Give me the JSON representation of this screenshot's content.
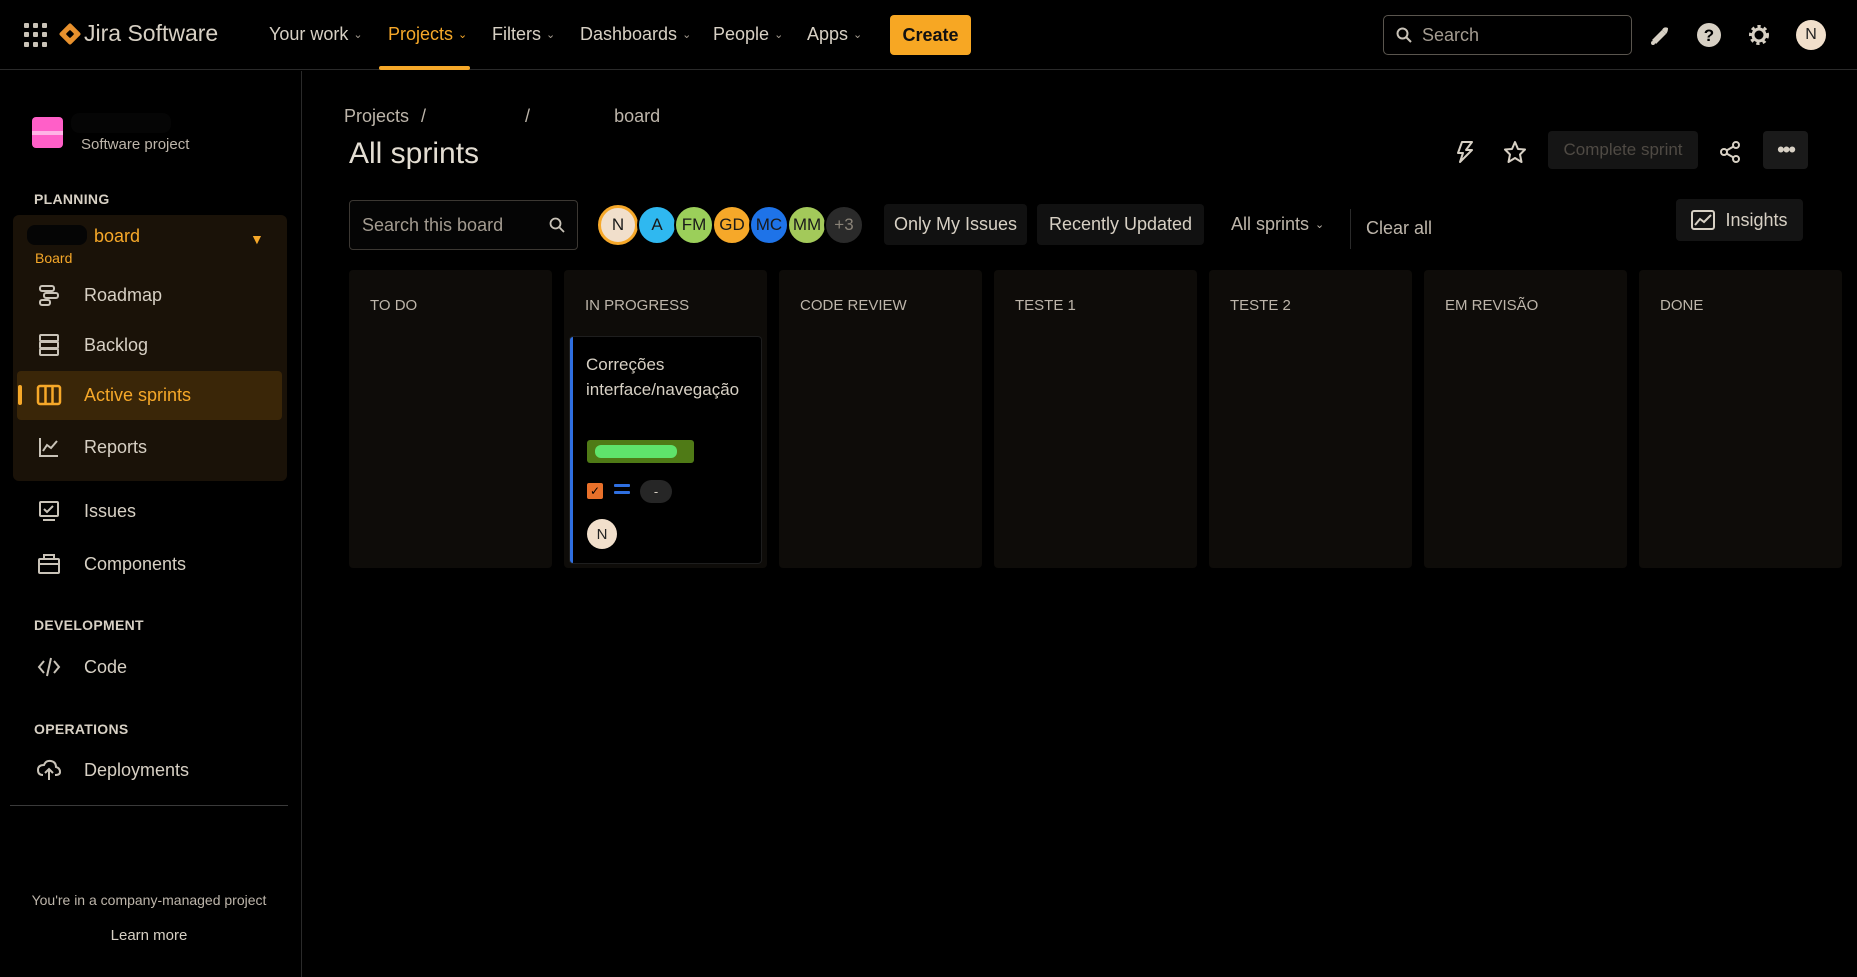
{
  "topnav": {
    "product": "Jira Software",
    "items": [
      {
        "label": "Your work"
      },
      {
        "label": "Projects"
      },
      {
        "label": "Filters"
      },
      {
        "label": "Dashboards"
      },
      {
        "label": "People"
      },
      {
        "label": "Apps"
      }
    ],
    "create_label": "Create",
    "search_placeholder": "Search",
    "user_initial": "N",
    "icons": [
      "notifications-icon",
      "help-icon",
      "settings-icon"
    ]
  },
  "sidebar": {
    "project_type": "Software project",
    "planning_title": "PLANNING",
    "board_title": "board",
    "board_subtitle": "Board",
    "planning_items": [
      {
        "label": "Roadmap",
        "icon": "roadmap-icon"
      },
      {
        "label": "Backlog",
        "icon": "backlog-icon"
      },
      {
        "label": "Active sprints",
        "icon": "board-columns-icon"
      },
      {
        "label": "Reports",
        "icon": "reports-icon"
      }
    ],
    "other_items": [
      {
        "label": "Issues",
        "icon": "issues-icon"
      },
      {
        "label": "Components",
        "icon": "components-icon"
      }
    ],
    "development_title": "DEVELOPMENT",
    "development_items": [
      {
        "label": "Code",
        "icon": "code-icon"
      }
    ],
    "operations_title": "OPERATIONS",
    "operations_items": [
      {
        "label": "Deployments",
        "icon": "deployments-icon"
      }
    ],
    "company_note": "You're in a company-managed project",
    "learn_more": "Learn more"
  },
  "header": {
    "breadcrumb": [
      "Projects",
      "/",
      "/",
      "board"
    ],
    "title": "All sprints",
    "complete_sprint": "Complete sprint",
    "more": "•••"
  },
  "filters": {
    "search_placeholder": "Search this board",
    "avatars": [
      {
        "initials": "N",
        "color": "#f1dfcb"
      },
      {
        "initials": "A",
        "color": "#2fb8f0"
      },
      {
        "initials": "FM",
        "color": "#9bcf5a"
      },
      {
        "initials": "GD",
        "color": "#f6a829"
      },
      {
        "initials": "MC",
        "color": "#1e73e8"
      },
      {
        "initials": "MM",
        "color": "#a3c95a"
      },
      {
        "initials": "+3",
        "color": "#2a2a2a"
      }
    ],
    "only_my_issues": "Only My Issues",
    "recently_updated": "Recently Updated",
    "all_sprints": "All sprints",
    "clear_all": "Clear all",
    "insights": "Insights"
  },
  "board": {
    "columns": [
      {
        "title": "TO DO"
      },
      {
        "title": "IN PROGRESS"
      },
      {
        "title": "CODE REVIEW"
      },
      {
        "title": "TESTE 1"
      },
      {
        "title": "TESTE 2"
      },
      {
        "title": "EM REVISÃO"
      },
      {
        "title": "DONE"
      }
    ],
    "card": {
      "title": "Correções interface/navegação",
      "estimate": "-",
      "assignee_initial": "N"
    }
  }
}
